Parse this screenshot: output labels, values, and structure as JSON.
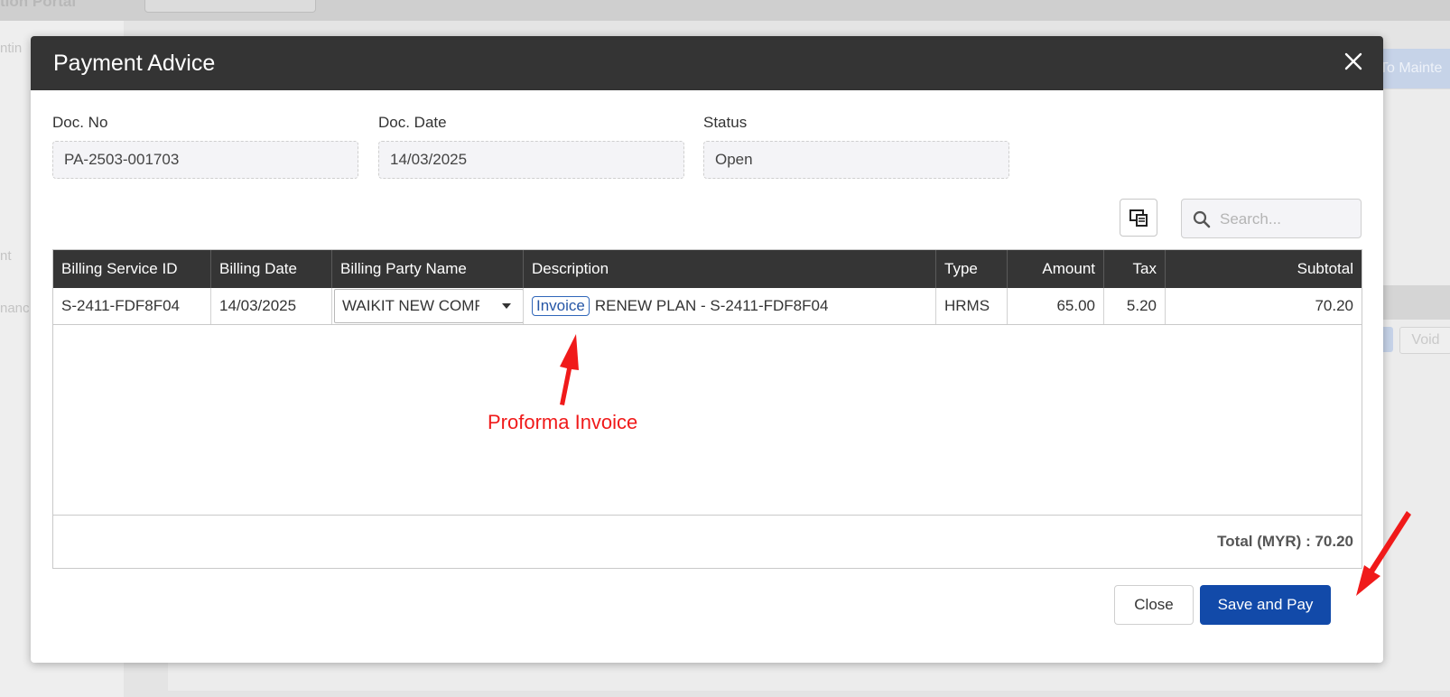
{
  "background": {
    "app_title": "tion Portal",
    "sidebar_fragments": [
      "ntin",
      "nt",
      "nanc"
    ],
    "maintenance_button": "To Mainte",
    "void_button": "Void"
  },
  "modal": {
    "title": "Payment Advice",
    "fields": {
      "doc_no": {
        "label": "Doc. No",
        "value": "PA-2503-001703"
      },
      "doc_date": {
        "label": "Doc. Date",
        "value": "14/03/2025"
      },
      "status": {
        "label": "Status",
        "value": "Open"
      }
    },
    "search": {
      "placeholder": "Search..."
    },
    "table": {
      "headers": {
        "billing_service_id": "Billing Service ID",
        "billing_date": "Billing Date",
        "billing_party_name": "Billing Party Name",
        "description": "Description",
        "type": "Type",
        "amount": "Amount",
        "tax": "Tax",
        "subtotal": "Subtotal"
      },
      "rows": [
        {
          "billing_service_id": "S-2411-FDF8F04",
          "billing_date": "14/03/2025",
          "billing_party_name": "WAIKIT NEW COMPANY",
          "description_badge": "Invoice",
          "description": "RENEW PLAN - S-2411-FDF8F04",
          "type": "HRMS",
          "amount": "65.00",
          "tax": "5.20",
          "subtotal": "70.20"
        }
      ],
      "total": "Total (MYR) : 70.20"
    },
    "buttons": {
      "close": "Close",
      "save_and_pay": "Save and Pay"
    }
  },
  "annotation": {
    "label": "Proforma Invoice",
    "color": "#f01a1a"
  },
  "colors": {
    "header_bg": "#343434",
    "primary": "#124aa9",
    "badge": "#2f66b9"
  }
}
